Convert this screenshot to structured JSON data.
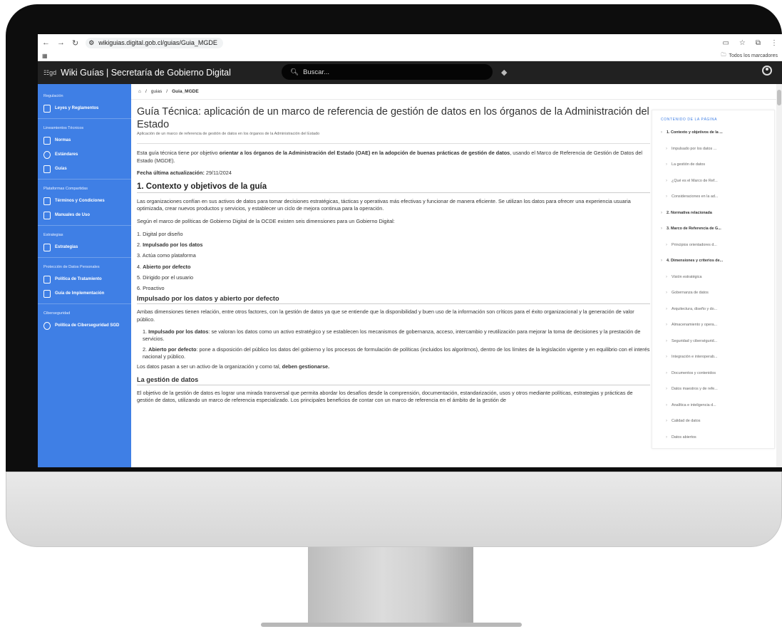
{
  "browser": {
    "url": "wikiguias.digital.gob.cl/guias/Guia_MGDE",
    "bookmarks_folder": "Todos los marcadores"
  },
  "header": {
    "title": "Wiki Guías | Secretaría de Gobierno Digital",
    "search_placeholder": "Buscar..."
  },
  "sidebar": {
    "groups": [
      {
        "label": "Regulación",
        "items": [
          {
            "label": "Leyes y Reglamentos"
          }
        ]
      },
      {
        "label": "Lineamientos Técnicos",
        "items": [
          {
            "label": "Normas"
          },
          {
            "label": "Estándares"
          },
          {
            "label": "Guías"
          }
        ]
      },
      {
        "label": "Plataformas Compartidas",
        "items": [
          {
            "label": "Términos y Condiciones"
          },
          {
            "label": "Manuales de Uso"
          }
        ]
      },
      {
        "label": "Estrategias",
        "items": [
          {
            "label": "Estrategias"
          }
        ]
      },
      {
        "label": "Protección de Datos Personales",
        "items": [
          {
            "label": "Política de Tratamiento"
          },
          {
            "label": "Guía de Implementación"
          }
        ]
      },
      {
        "label": "Ciberseguridad",
        "items": [
          {
            "label": "Política de Ciberseguridad SGD"
          }
        ]
      }
    ]
  },
  "breadcrumb": {
    "sep": "/",
    "items": [
      "guias",
      "Guia_MGDE"
    ]
  },
  "page": {
    "title": "Guía Técnica: aplicación de un marco de referencia de gestión de datos en los órganos de la Administración del Estado",
    "subtitle": "Aplicación de un marco de referencia de gestión de datos en los órganos de la Administración del Estado",
    "intro_a": "Esta guía técnica tiene por objetivo ",
    "intro_b": "orientar a los órganos de la Administración del Estado (OAE) en la adopción de buenas prácticas de gestión de datos",
    "intro_c": ", usando el Marco de Referencia de Gestión de Datos del Estado (MGDE).",
    "updated_label": "Fecha última actualización:",
    "updated_value": " 29/11/2024",
    "h1": "1. Contexto y objetivos de la guía",
    "p1": "Las organizaciones confían en sus activos de datos para tomar decisiones estratégicas, tácticas y operativas más efectivas y funcionar de manera eficiente. Se utilizan los datos para ofrecer una experiencia usuaria optimizada, crear nuevos productos y servicios, y establecer un ciclo de mejora continua para la operación.",
    "p2": "Según el marco de políticas de Gobierno Digital de la OCDE existen seis dimensiones para un Gobierno Digital:",
    "dims": [
      {
        "n": "1. ",
        "t": "Digital por diseño",
        "bold": false
      },
      {
        "n": "2. ",
        "t": "Impulsado por los datos",
        "bold": true
      },
      {
        "n": "3. ",
        "t": "Actúa como plataforma",
        "bold": false
      },
      {
        "n": "4. ",
        "t": "Abierto por defecto",
        "bold": true
      },
      {
        "n": "5. ",
        "t": "Dirigido por el usuario",
        "bold": false
      },
      {
        "n": "6. ",
        "t": "Proactivo",
        "bold": false
      }
    ],
    "h2": "Impulsado por los datos y abierto por defecto",
    "p3": "Ambas dimensiones tienen relación, entre otros factores, con la gestión de datos ya que se entiende que la disponibilidad y buen uso de la información son críticos para el éxito organizacional y la generación de valor público.",
    "details": [
      {
        "n": "1. ",
        "b": "Impulsado por los datos",
        "t": ": se valoran los datos como un activo estratégico y se establecen los mecanismos de gobernanza, acceso, intercambio y reutilización para mejorar la toma de decisiones y la prestación de servicios."
      },
      {
        "n": "2. ",
        "b": "Abierto por defecto",
        "t": ": pone a disposición del público los datos del gobierno y los procesos de formulación de políticas (incluidos los algoritmos), dentro de los límites de la legislación vigente y en equilibrio con el interés nacional y público."
      }
    ],
    "p4_a": "Los datos pasan a ser un activo de la organización y como tal, ",
    "p4_b": "deben gestionarse.",
    "h3": "La gestión de datos",
    "p5": "El objetivo de la gestión de datos es lograr una mirada transversal que permita abordar los desafíos desde la comprensión, documentación, estandarización, usos y otros mediante políticas, estrategias y prácticas de gestión de datos, utilizando un marco de referencia especializado. Los principales beneficios de contar con un marco de referencia en el ámbito de la gestión de"
  },
  "toc": {
    "title": "CONTENIDO DE LA PÁGINA",
    "items": [
      {
        "label": "1. Contexto y objetivos de la ...",
        "sub": false
      },
      {
        "label": "Impulsado por los datos ...",
        "sub": true
      },
      {
        "label": "La gestión de datos",
        "sub": true
      },
      {
        "label": "¿Qué es el Marco de Ref...",
        "sub": true
      },
      {
        "label": "Consideraciones en la ad...",
        "sub": true
      },
      {
        "label": "2. Normativa relacionada",
        "sub": false
      },
      {
        "label": "3. Marco de Referencia de G...",
        "sub": false
      },
      {
        "label": "Principios orientadores d...",
        "sub": true
      },
      {
        "label": "4. Dimensiones y criterios de...",
        "sub": false
      },
      {
        "label": "Visión estratégica",
        "sub": true
      },
      {
        "label": "Gobernanza de datos",
        "sub": true
      },
      {
        "label": "Arquitectura, diseño y do...",
        "sub": true
      },
      {
        "label": "Almacenamiento y opera...",
        "sub": true
      },
      {
        "label": "Seguridad y ciberségurid...",
        "sub": true
      },
      {
        "label": "Integración e interoperab...",
        "sub": true
      },
      {
        "label": "Documentos y contenidos",
        "sub": true
      },
      {
        "label": "Datos maestros y de refe...",
        "sub": true
      },
      {
        "label": "Analítica e inteligencia d...",
        "sub": true
      },
      {
        "label": "Calidad de datos",
        "sub": true
      },
      {
        "label": "Datos abiertos",
        "sub": true
      }
    ]
  }
}
